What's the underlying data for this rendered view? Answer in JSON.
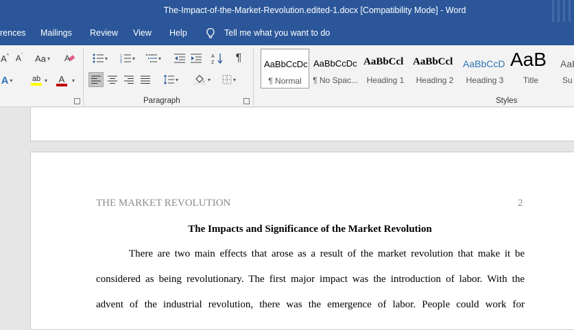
{
  "window": {
    "title": "The-Impact-of-the-Market-Revolution.edited-1.docx [Compatibility Mode]  -  Word"
  },
  "menu": {
    "items": [
      "rences",
      "Mailings",
      "Review",
      "View",
      "Help"
    ],
    "tell_me": "Tell me what you want to do"
  },
  "ribbon": {
    "font_row1": {
      "grow": "A",
      "shrink": "A",
      "case": "Aa"
    },
    "font_row2": {
      "text_effects": "A",
      "highlight": "ab",
      "font_color": "A"
    },
    "paragraph_label": "Paragraph",
    "styles_label": "Styles",
    "pilcrow": "¶",
    "sort": "A↓Z",
    "styles": [
      {
        "sample": "AaBbCcDc",
        "name": "¶ Normal"
      },
      {
        "sample": "AaBbCcDc",
        "name": "¶ No Spac..."
      },
      {
        "sample": "AaBbCcl",
        "name": "Heading 1"
      },
      {
        "sample": "AaBbCcl",
        "name": "Heading 2"
      },
      {
        "sample": "AaBbCcD",
        "name": "Heading 3"
      },
      {
        "sample": "AaB",
        "name": "Title"
      },
      {
        "sample": "AaBl",
        "name": "Su"
      }
    ],
    "colors": {
      "highlight": "#ffff00",
      "font_color": "#c00000",
      "title_blue": "#2e74b5"
    }
  },
  "document": {
    "running_head": "THE MARKET REVOLUTION",
    "page_number": "2",
    "title": "The Impacts and Significance of the Market Revolution",
    "lines": [
      "There are two main effects that arose as a result of the market revolution that make it be",
      "considered as being revolutionary. The first major impact was the introduction of labor. With the",
      "advent of the industrial revolution, there was the emergence of labor. People could work for"
    ]
  },
  "colors": {
    "titlebar": "#2b579a",
    "ribbon": "#f3f3f3",
    "canvas": "#e6e6e6"
  }
}
